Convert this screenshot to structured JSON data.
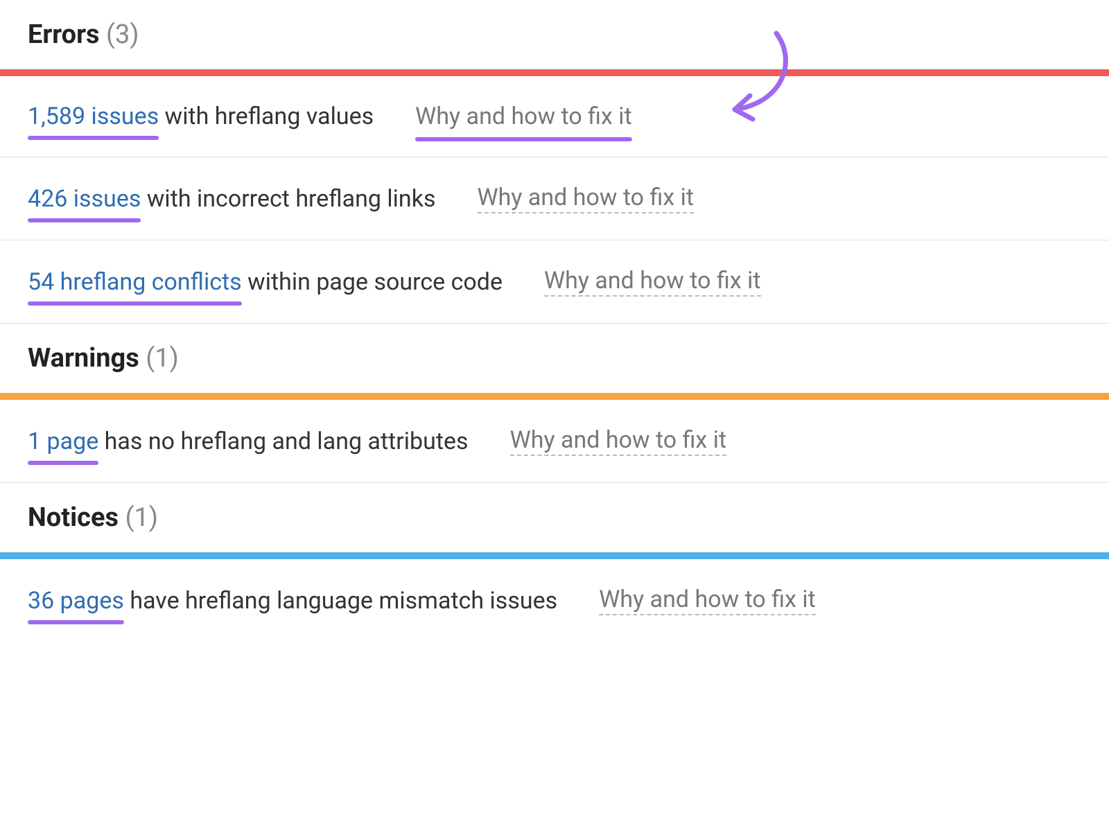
{
  "sections": {
    "errors": {
      "title": "Errors",
      "count": "(3)",
      "items": [
        {
          "link_text": "1,589 issues",
          "rest": " with hreflang values",
          "why": "Why and how to fix it"
        },
        {
          "link_text": "426 issues",
          "rest": " with incorrect hreflang links",
          "why": "Why and how to fix it"
        },
        {
          "link_text": "54 hreflang conflicts",
          "rest": " within page source code",
          "why": "Why and how to fix it"
        }
      ]
    },
    "warnings": {
      "title": "Warnings",
      "count": "(1)",
      "items": [
        {
          "link_text": "1 page",
          "rest": " has no hreflang and lang attributes",
          "why": "Why and how to fix it"
        }
      ]
    },
    "notices": {
      "title": "Notices",
      "count": "(1)",
      "items": [
        {
          "link_text": "36 pages",
          "rest": " have hreflang language mismatch issues",
          "why": "Why and how to fix it"
        }
      ]
    }
  }
}
